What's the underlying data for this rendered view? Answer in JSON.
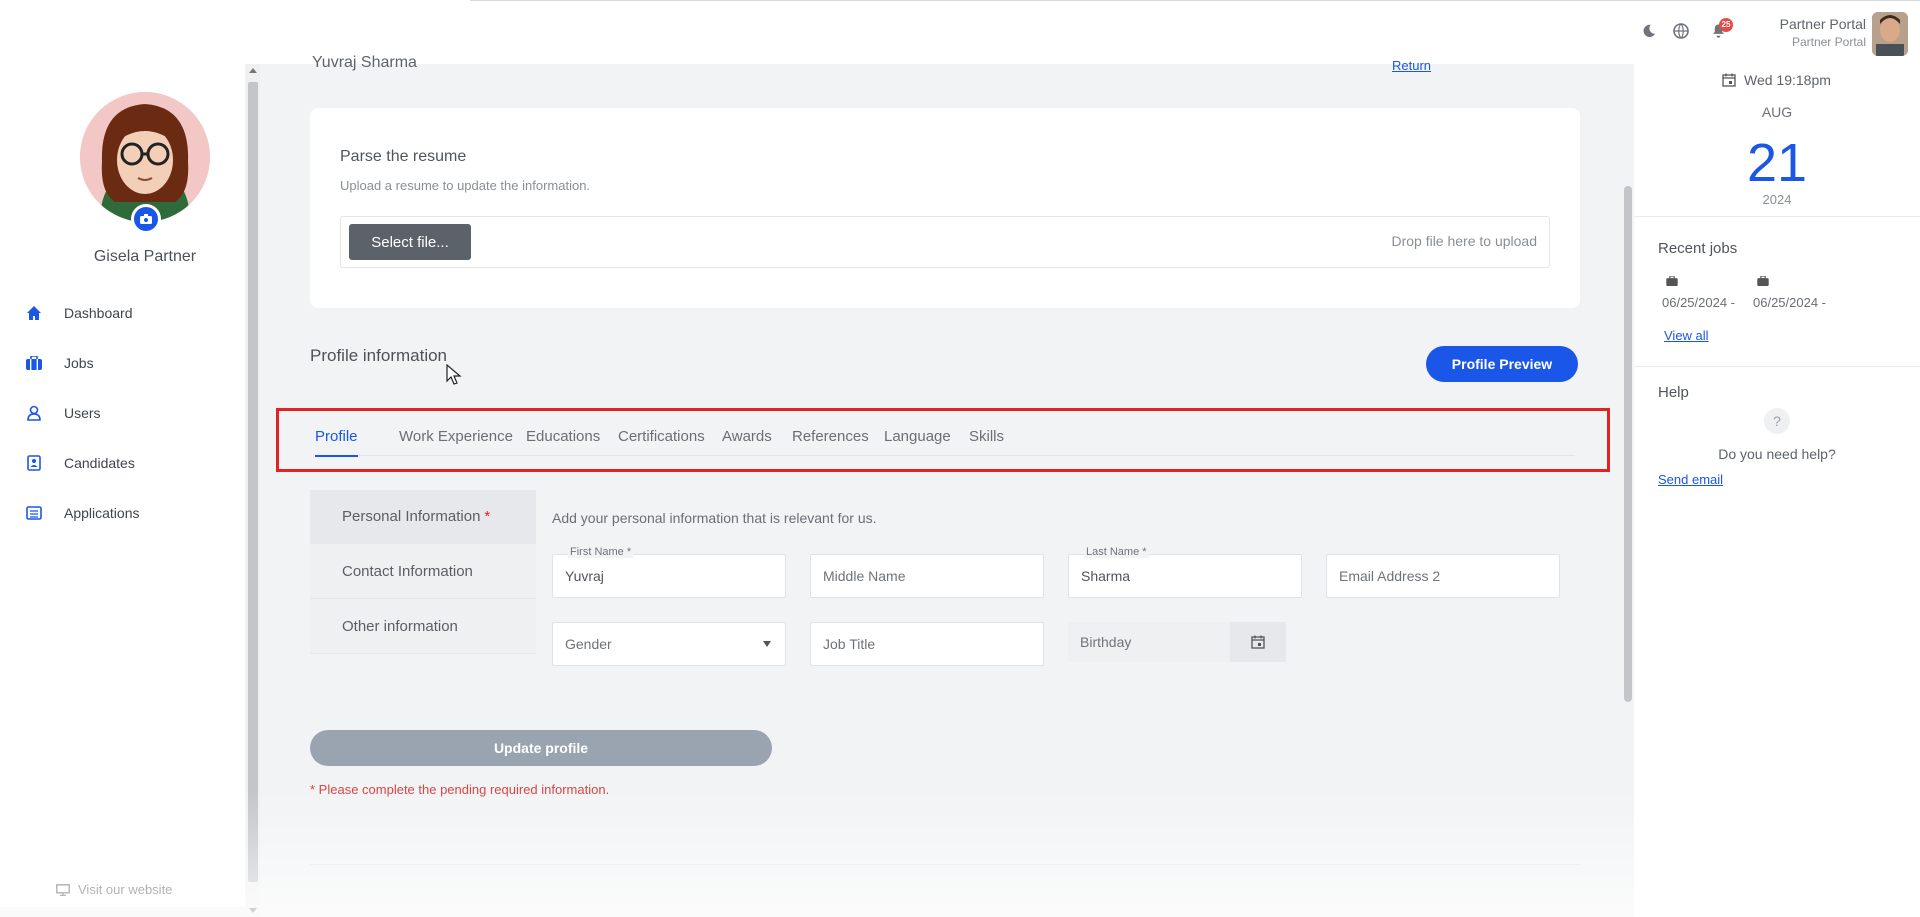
{
  "header": {
    "user_name": "Partner Portal",
    "user_sub": "Partner Portal",
    "notifications_count": "25",
    "icons": [
      "moon-icon",
      "globe-icon",
      "bell-icon"
    ]
  },
  "sidebar": {
    "username": "Gisela Partner",
    "items": [
      {
        "label": "Dashboard",
        "icon": "home-icon"
      },
      {
        "label": "Jobs",
        "icon": "briefcase-icon"
      },
      {
        "label": "Users",
        "icon": "user-icon"
      },
      {
        "label": "Candidates",
        "icon": "id-card-icon"
      },
      {
        "label": "Applications",
        "icon": "list-icon"
      }
    ],
    "visit_website": "Visit our website"
  },
  "main": {
    "candidate_name": "Yuvraj Sharma",
    "return_label": "Return",
    "resume": {
      "title": "Parse the resume",
      "subtitle": "Upload a resume to update the information.",
      "select_file": "Select file...",
      "drop_hint": "Drop file here to upload"
    },
    "profile_info_title": "Profile information",
    "profile_preview": "Profile Preview",
    "tabs": [
      {
        "label": "Profile",
        "active": true
      },
      {
        "label": "Work Experience"
      },
      {
        "label": "Educations"
      },
      {
        "label": "Certifications"
      },
      {
        "label": "Awards"
      },
      {
        "label": "References"
      },
      {
        "label": "Language"
      },
      {
        "label": "Skills"
      }
    ],
    "subnav": [
      {
        "label": "Personal Information",
        "required": "*"
      },
      {
        "label": "Contact Information"
      },
      {
        "label": "Other information"
      }
    ],
    "personal_desc": "Add your personal information that is relevant for us.",
    "fields": {
      "first_name_label": "First Name *",
      "first_name_value": "Yuvraj",
      "middle_name_placeholder": "Middle Name",
      "last_name_label": "Last Name *",
      "last_name_value": "Sharma",
      "email2_placeholder": "Email Address 2",
      "gender_placeholder": "Gender",
      "job_title_placeholder": "Job Title",
      "birthday_placeholder": "Birthday"
    },
    "update_button": "Update profile",
    "pending_note": "* Please complete the pending required information."
  },
  "right_panel": {
    "date_line": "Wed 19:18pm",
    "month": "AUG",
    "day": "21",
    "year": "2024",
    "recent_jobs_title": "Recent jobs",
    "recent_jobs": [
      "06/25/2024 -",
      "06/25/2024 -"
    ],
    "view_all": "View all",
    "help_title": "Help",
    "help_question": "Do you need help?",
    "send_email": "Send email"
  },
  "colors": {
    "accent": "#1a56e8",
    "highlight_box": "#e02424",
    "disabled_button": "#9aa4b0"
  }
}
